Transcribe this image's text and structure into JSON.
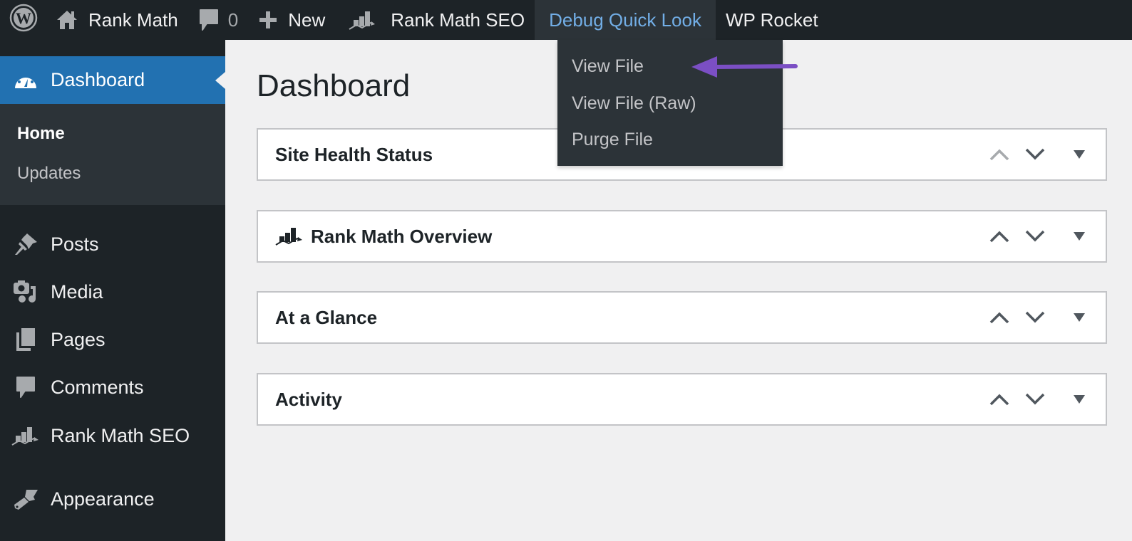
{
  "adminbar": {
    "site_name": "Rank Math",
    "comments_count": "0",
    "new_label": "New",
    "rankmath_label": "Rank Math SEO",
    "debug_label": "Debug Quick Look",
    "rocket_label": "WP Rocket",
    "debug_menu": [
      {
        "label": "View File"
      },
      {
        "label": "View File (Raw)"
      },
      {
        "label": "Purge File"
      }
    ]
  },
  "sidebar": {
    "dashboard_label": "Dashboard",
    "dashboard_sub": [
      {
        "label": "Home",
        "current": true
      },
      {
        "label": "Updates",
        "current": false
      }
    ],
    "items": [
      {
        "label": "Posts",
        "icon": "pin-icon"
      },
      {
        "label": "Media",
        "icon": "media-icon"
      },
      {
        "label": "Pages",
        "icon": "pages-icon"
      },
      {
        "label": "Comments",
        "icon": "comment-icon"
      },
      {
        "label": "Rank Math SEO",
        "icon": "rank-math-icon"
      },
      {
        "label": "Appearance",
        "icon": "paintbrush-icon"
      }
    ]
  },
  "main": {
    "page_title": "Dashboard",
    "panels": [
      {
        "title": "Site Health Status",
        "move_up_disabled": true
      },
      {
        "title": "Rank Math Overview",
        "move_up_disabled": false
      },
      {
        "title": "At a Glance",
        "move_up_disabled": false
      },
      {
        "title": "Activity",
        "move_up_disabled": false
      }
    ]
  },
  "colors": {
    "adminbar_bg": "#1d2327",
    "menu_bg": "#1d2327",
    "submenu_bg": "#2c3338",
    "accent_blue": "#2271b1",
    "link_blue": "#72aee6",
    "annotation_arrow": "#7b4fc4"
  }
}
